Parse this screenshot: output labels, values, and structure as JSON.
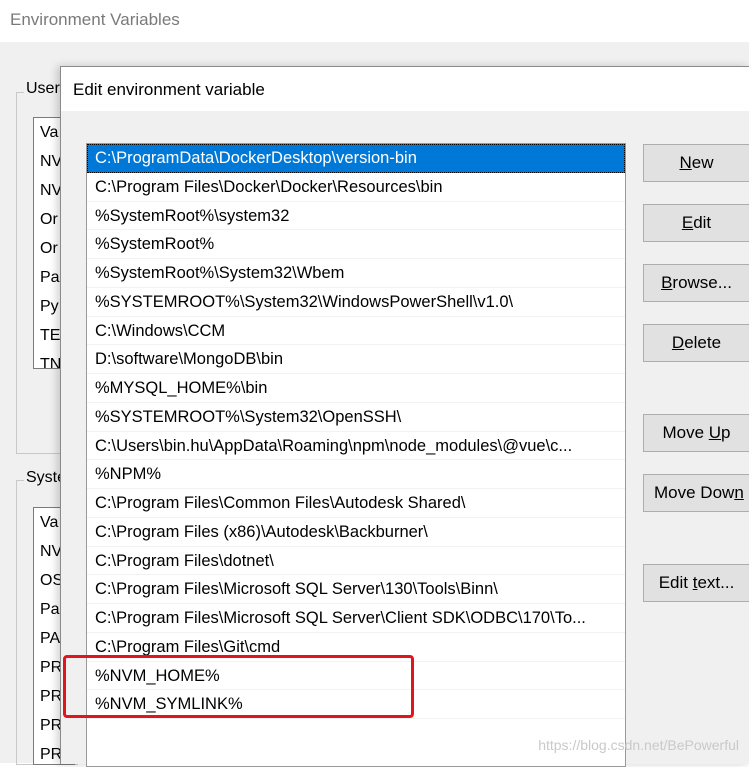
{
  "parent": {
    "title": "Environment Variables",
    "user_group_label": "User",
    "user_list": [
      "Va",
      "NV",
      "NV",
      "Or",
      "Or",
      "Pa",
      "Py",
      "TE",
      "TN"
    ],
    "system_group_label": "Syste",
    "system_list": [
      "Va",
      "NV",
      "OS",
      "Pa",
      "PA",
      "PR",
      "PR",
      "PR",
      "PR"
    ]
  },
  "dialog": {
    "title": "Edit environment variable",
    "paths": [
      "C:\\ProgramData\\DockerDesktop\\version-bin",
      "C:\\Program Files\\Docker\\Docker\\Resources\\bin",
      "%SystemRoot%\\system32",
      "%SystemRoot%",
      "%SystemRoot%\\System32\\Wbem",
      "%SYSTEMROOT%\\System32\\WindowsPowerShell\\v1.0\\",
      "C:\\Windows\\CCM",
      "D:\\software\\MongoDB\\bin",
      "%MYSQL_HOME%\\bin",
      "%SYSTEMROOT%\\System32\\OpenSSH\\",
      "C:\\Users\\bin.hu\\AppData\\Roaming\\npm\\node_modules\\@vue\\c...",
      "%NPM%",
      "C:\\Program Files\\Common Files\\Autodesk Shared\\",
      "C:\\Program Files (x86)\\Autodesk\\Backburner\\",
      "C:\\Program Files\\dotnet\\",
      "C:\\Program Files\\Microsoft SQL Server\\130\\Tools\\Binn\\",
      "C:\\Program Files\\Microsoft SQL Server\\Client SDK\\ODBC\\170\\To...",
      "C:\\Program Files\\Git\\cmd",
      "%NVM_HOME%",
      "%NVM_SYMLINK%"
    ],
    "selected_index": 0,
    "buttons": {
      "new": {
        "u": "N",
        "rest": "ew"
      },
      "edit": {
        "u": "E",
        "rest": "dit"
      },
      "browse": {
        "u": "B",
        "rest": "rowse..."
      },
      "delete": {
        "u": "D",
        "rest": "elete"
      },
      "move_up": {
        "pre": "Move ",
        "u": "U",
        "rest": "p"
      },
      "move_down": {
        "pre": "Move Dow",
        "u": "n",
        "rest": ""
      },
      "edit_text": {
        "pre": "Edit ",
        "u": "t",
        "rest": "ext..."
      }
    }
  },
  "watermark": "https://blog.csdn.net/BePowerful",
  "colors": {
    "selection": "#0078d7",
    "highlight": "#e0161e"
  }
}
